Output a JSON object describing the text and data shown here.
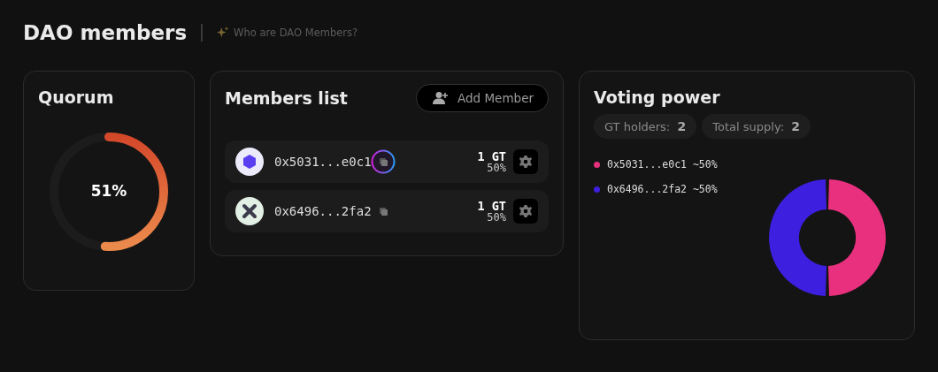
{
  "header": {
    "title": "DAO members",
    "help_link": "Who are DAO Members?"
  },
  "quorum": {
    "title": "Quorum",
    "level": 0.51,
    "reading": "51%"
  },
  "members": {
    "title": "Members list",
    "add_button": "Add Member",
    "rows": [
      {
        "kind": "hexagon",
        "address": "0x5031...e0c1",
        "copy_highlighted": true,
        "amount": "1 GT",
        "share": "50%"
      },
      {
        "kind": "cross",
        "address": "0x6496...2fa2",
        "copy_highlighted": false,
        "amount": "1 GT",
        "share": "50%"
      }
    ]
  },
  "voting_power": {
    "title": "Voting power",
    "stats": [
      {
        "label": "GT holders:",
        "value": "2"
      },
      {
        "label": "Total supply:",
        "value": "2"
      }
    ],
    "legend": [
      {
        "address": "0x5031...e0c1",
        "share": "~50%",
        "color": "#e8307f"
      },
      {
        "address": "0x6496...2fa2",
        "share": "~50%",
        "color": "#3d1fe0"
      }
    ],
    "chart_data": {
      "type": "donut",
      "values": [
        50,
        50
      ]
    }
  }
}
